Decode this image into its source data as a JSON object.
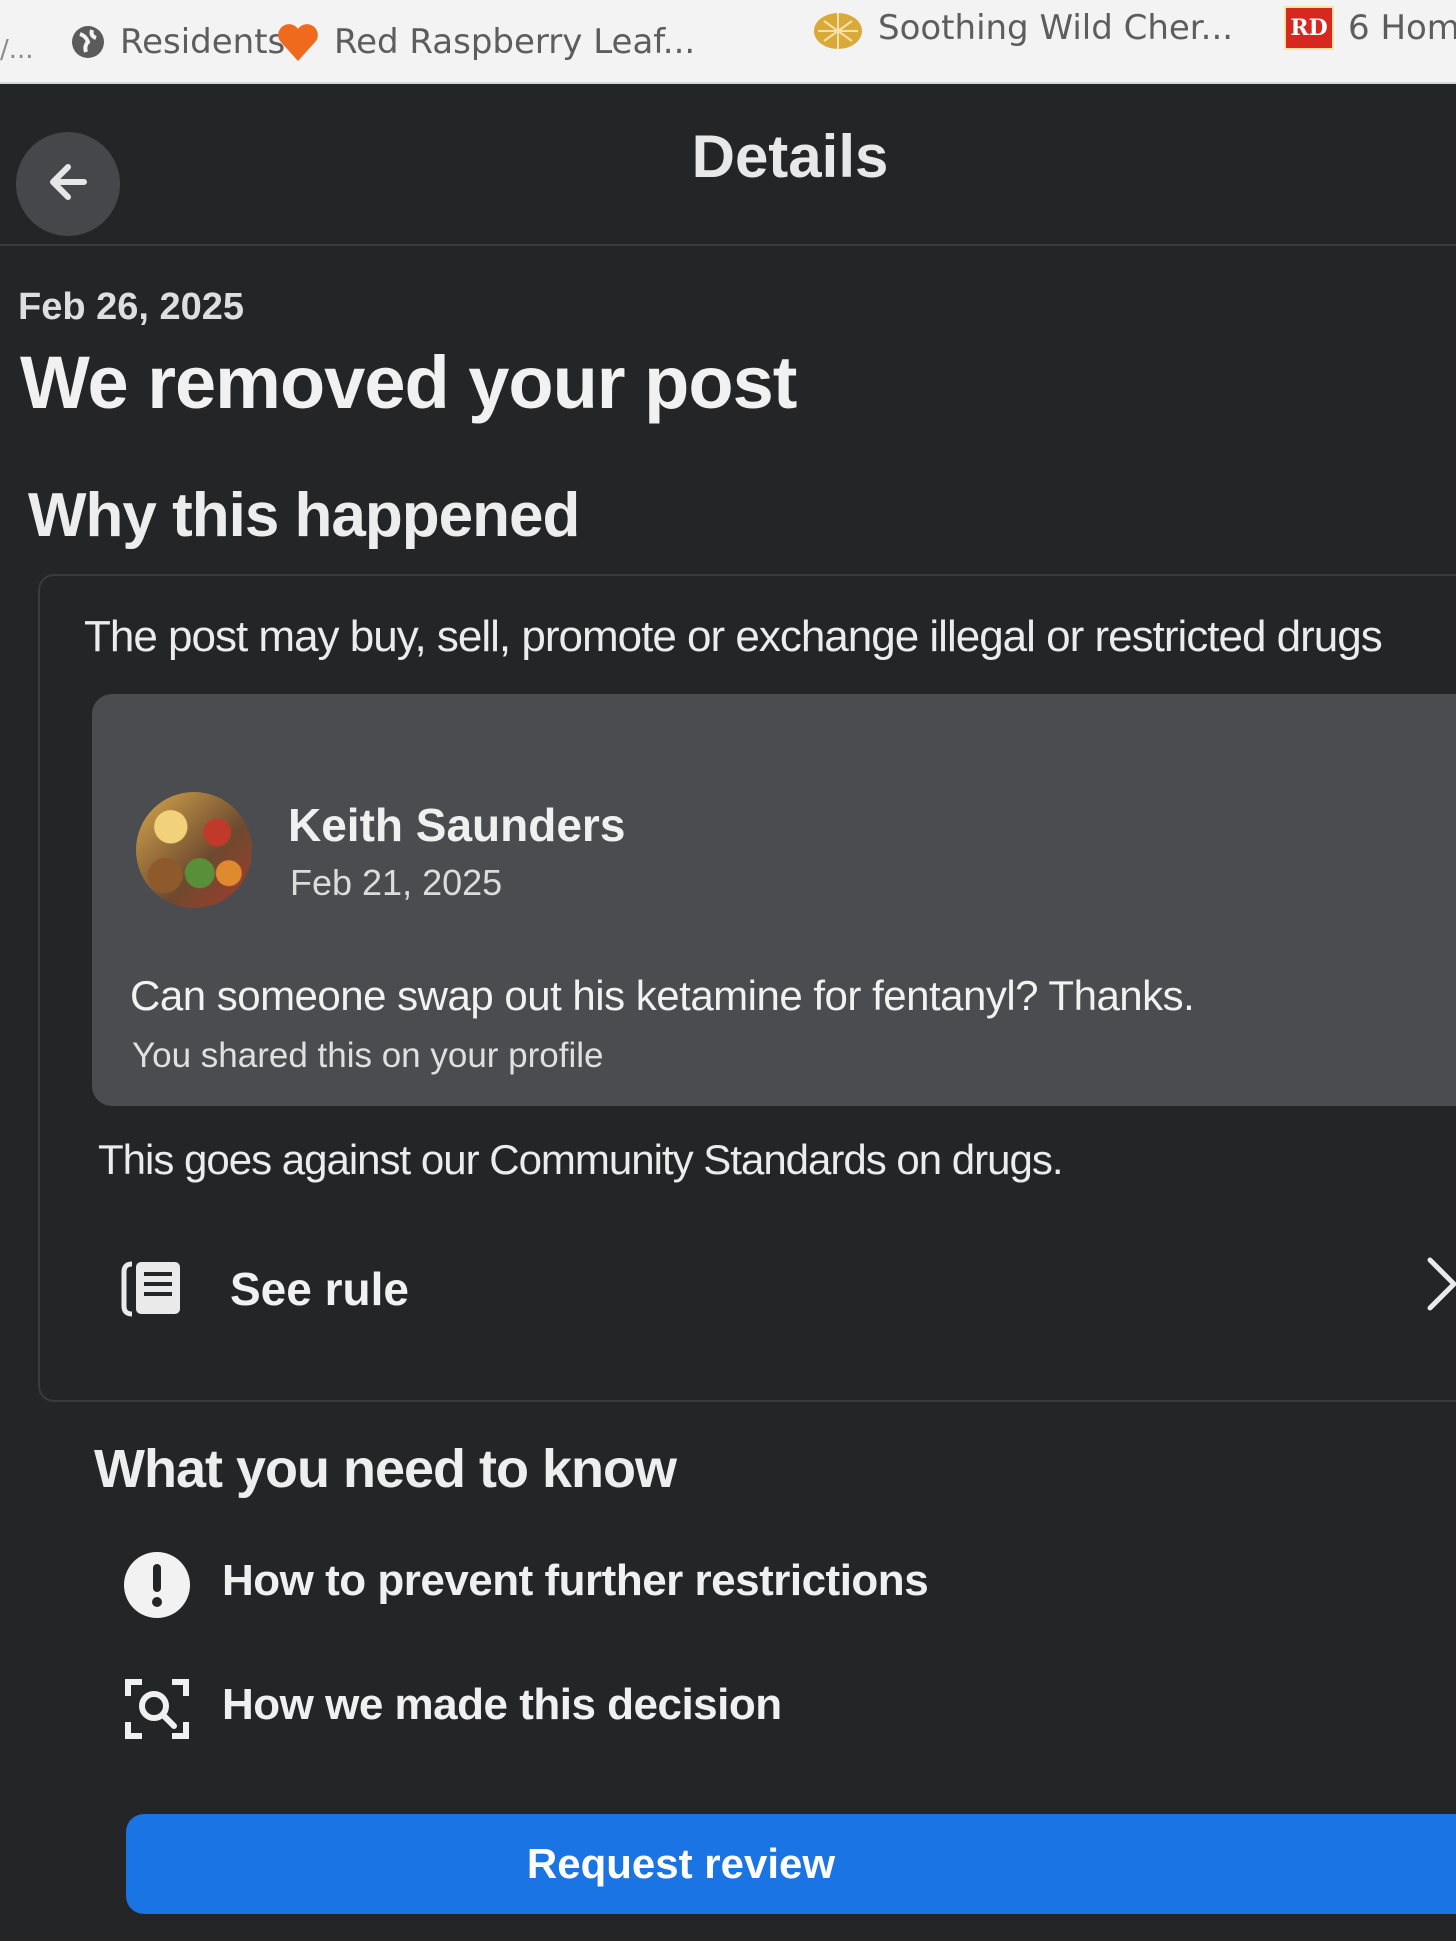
{
  "bookmarks_bar": {
    "items": [
      {
        "label": "Residents",
        "icon": "globe-icon"
      },
      {
        "label": "Red Raspberry Leaf...",
        "icon": "heart-icon"
      },
      {
        "label": "Soothing Wild Cher...",
        "icon": "leaf-icon"
      },
      {
        "label": "6 Hom",
        "icon": "rd-icon",
        "badge": "RD"
      }
    ],
    "overflow_label": "/..."
  },
  "header": {
    "title": "Details",
    "back_icon": "arrow-left-icon"
  },
  "notice": {
    "date": "Feb 26, 2025",
    "title": "We removed your post"
  },
  "why": {
    "heading": "Why this happened",
    "reason": "The post may buy, sell, promote or exchange illegal or restricted drugs",
    "post": {
      "author": "Keith Saunders",
      "date": "Feb 21, 2025",
      "text": "Can someone swap out his ketamine for fentanyl? Thanks.",
      "shared_note": "You shared this on your profile"
    },
    "standards_text": "This goes against our Community Standards on drugs.",
    "see_rule_label": "See rule"
  },
  "know": {
    "heading": "What you need to know",
    "items": [
      {
        "label": "How to prevent further restrictions",
        "icon": "exclamation-circle-icon"
      },
      {
        "label": "How we made this decision",
        "icon": "scan-search-icon"
      }
    ]
  },
  "actions": {
    "request_review_label": "Request review"
  },
  "colors": {
    "background": "#242527",
    "post_box": "#4b4c4f",
    "primary_button": "#1b74e4",
    "text": "#f0f0f0"
  }
}
